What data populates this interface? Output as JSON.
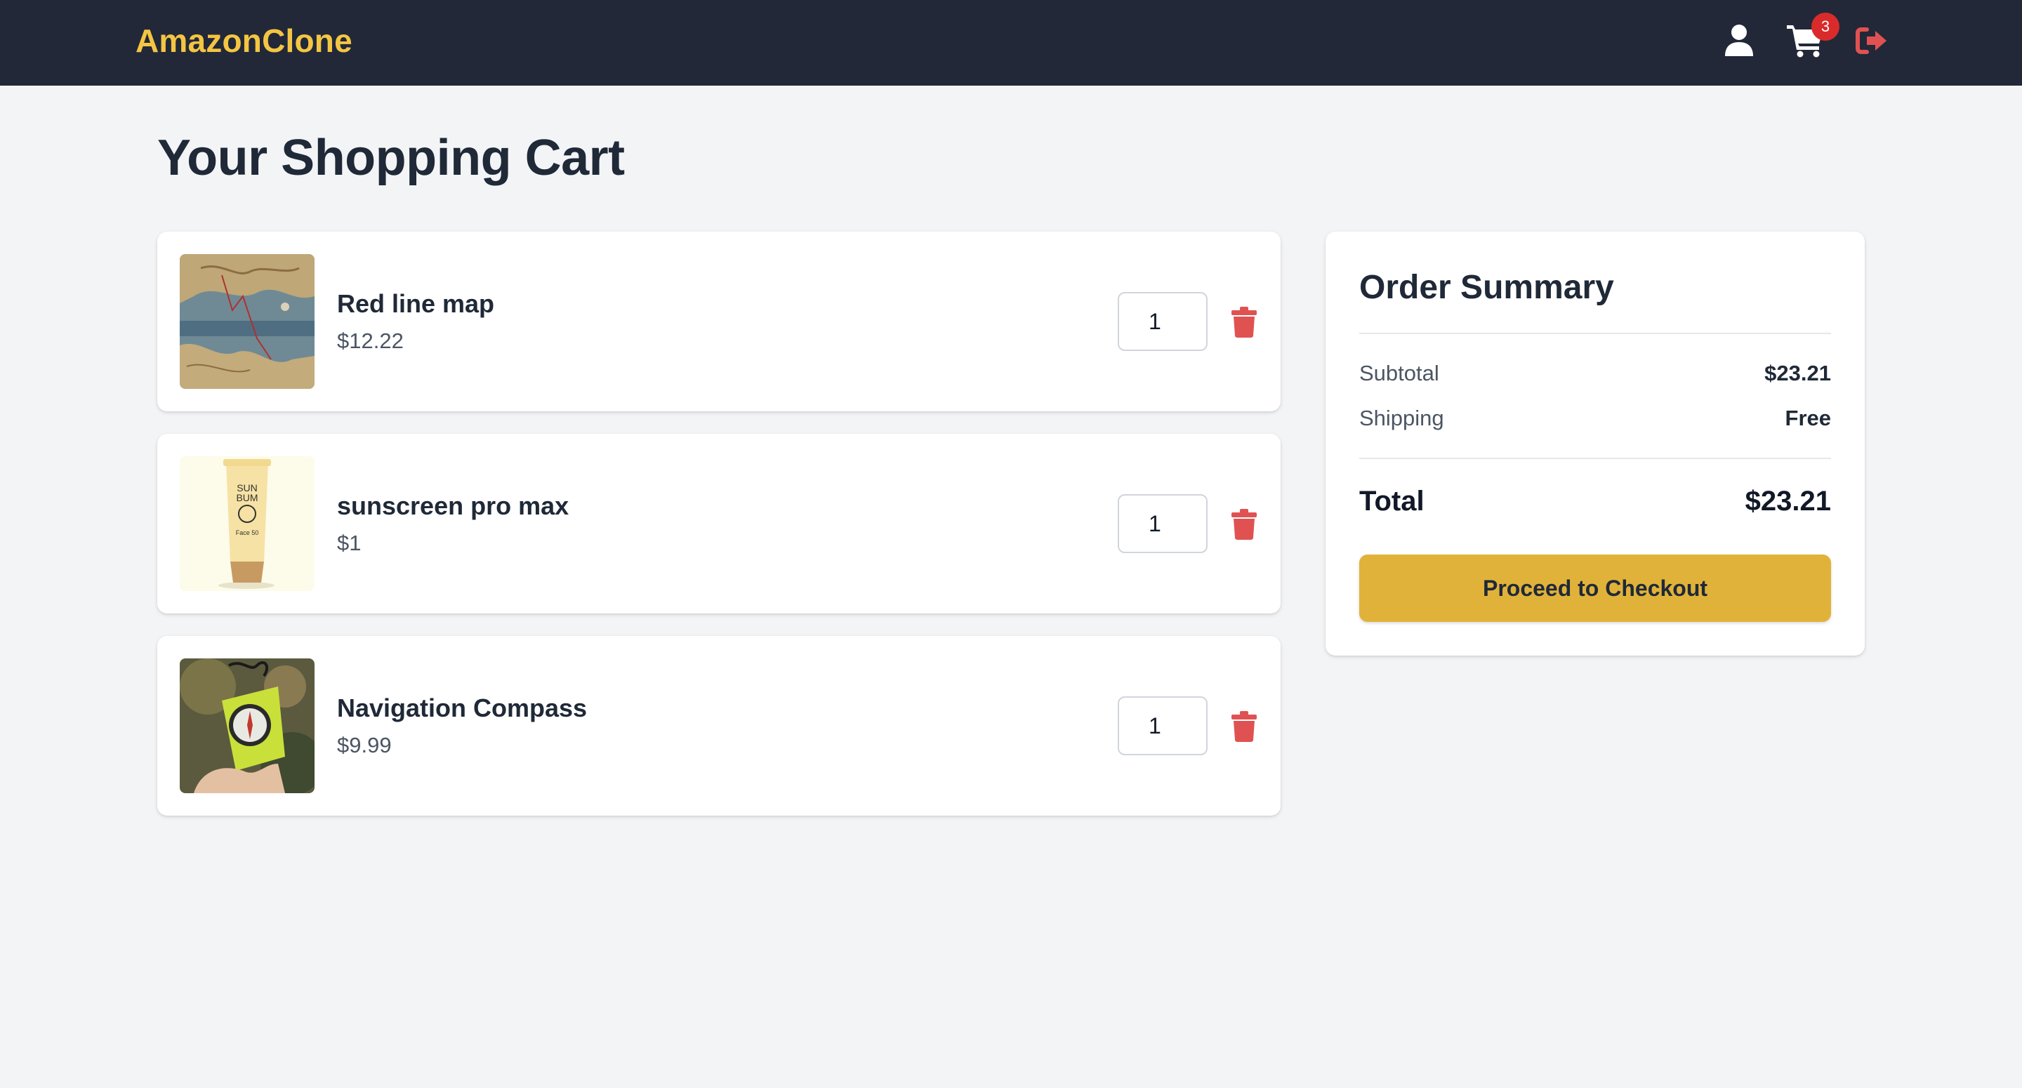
{
  "navbar": {
    "brand": "AmazonClone",
    "cart_count": "3",
    "icons": [
      "user-icon",
      "cart-icon",
      "logout-icon"
    ],
    "colors": {
      "background": "#222838",
      "brand": "#f4c542",
      "badge": "#d92b2b",
      "logout": "#e05252"
    }
  },
  "page": {
    "title": "Your Shopping Cart"
  },
  "cart": {
    "items": [
      {
        "name": "Red line map",
        "price": "$12.22",
        "quantity": "1",
        "image": "map-thumbnail"
      },
      {
        "name": "sunscreen pro max",
        "price": "$1",
        "quantity": "1",
        "image": "sunscreen-thumbnail"
      },
      {
        "name": "Navigation Compass",
        "price": "$9.99",
        "quantity": "1",
        "image": "compass-thumbnail"
      }
    ]
  },
  "summary": {
    "title": "Order Summary",
    "subtotal_label": "Subtotal",
    "subtotal_value": "$23.21",
    "shipping_label": "Shipping",
    "shipping_value": "Free",
    "total_label": "Total",
    "total_value": "$23.21",
    "checkout_label": "Proceed to Checkout"
  },
  "colors": {
    "accent": "#e1b23a",
    "delete": "#e05252",
    "page_bg": "#f3f4f6"
  }
}
